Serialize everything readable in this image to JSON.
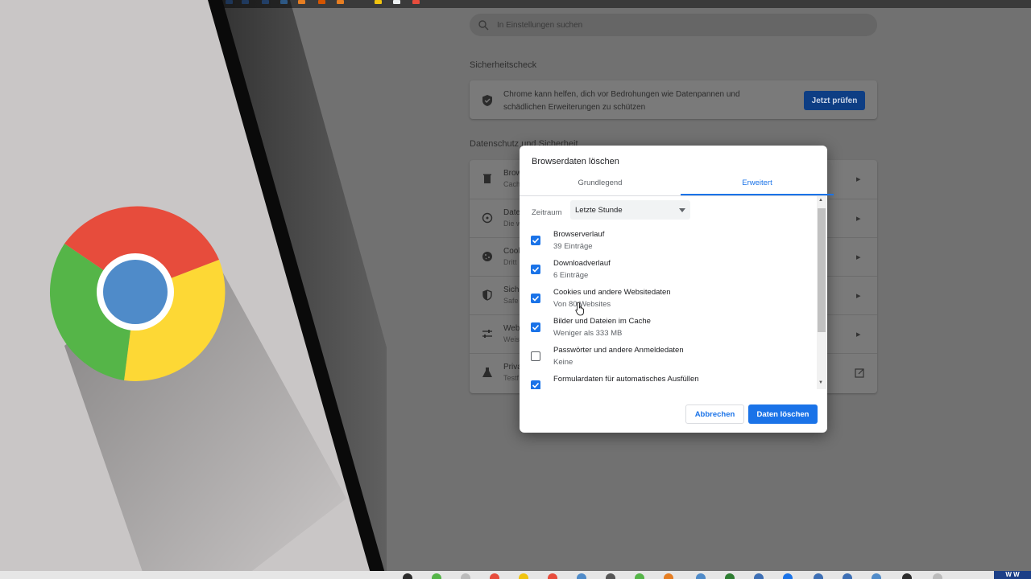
{
  "colors": {
    "accent": "#1a73e8",
    "chrome_red": "#e74c3c",
    "chrome_yellow": "#fdd835",
    "chrome_green": "#55b548",
    "chrome_blue": "#4f8bc9"
  },
  "settings": {
    "search_placeholder": "In Einstellungen suchen",
    "safety_check": {
      "title": "Sicherheitscheck",
      "description": "Chrome kann helfen, dich vor Bedrohungen wie Datenpannen und schädlichen Erweiterungen zu schützen",
      "button": "Jetzt prüfen"
    },
    "privacy": {
      "title": "Datenschutz und Sicherheit",
      "rows": [
        {
          "icon": "trash-icon",
          "title": "Brow",
          "subtitle": "Cach"
        },
        {
          "icon": "compass-icon",
          "title": "Date",
          "subtitle": "Die w"
        },
        {
          "icon": "cookie-icon",
          "title": "Cook",
          "subtitle": "Dritt"
        },
        {
          "icon": "shield-icon",
          "title": "Sich",
          "subtitle": "Safe"
        },
        {
          "icon": "sliders-icon",
          "title": "Web",
          "subtitle": "Weise"
        },
        {
          "icon": "flask-icon",
          "title": "Priva",
          "subtitle": "Testf"
        }
      ]
    }
  },
  "dialog": {
    "title": "Browserdaten löschen",
    "tabs": {
      "basic": "Grundlegend",
      "advanced": "Erweitert"
    },
    "range_label": "Zeitraum",
    "range_value": "Letzte Stunde",
    "items": [
      {
        "label": "Browserverlauf",
        "detail": "39 Einträge",
        "checked": true
      },
      {
        "label": "Downloadverlauf",
        "detail": "6 Einträge",
        "checked": true
      },
      {
        "label": "Cookies und andere Websitedaten",
        "detail": "Von 80 Websites",
        "checked": true
      },
      {
        "label": "Bilder und Dateien im Cache",
        "detail": "Weniger als 333 MB",
        "checked": true
      },
      {
        "label": "Passwörter und andere Anmeldedaten",
        "detail": "Keine",
        "checked": false
      },
      {
        "label": "Formulardaten für automatisches Ausfüllen",
        "detail": "",
        "checked": true
      }
    ],
    "cancel_label": "Abbrechen",
    "delete_label": "Daten löschen"
  },
  "taskbar": {
    "corner_label": "W W"
  }
}
